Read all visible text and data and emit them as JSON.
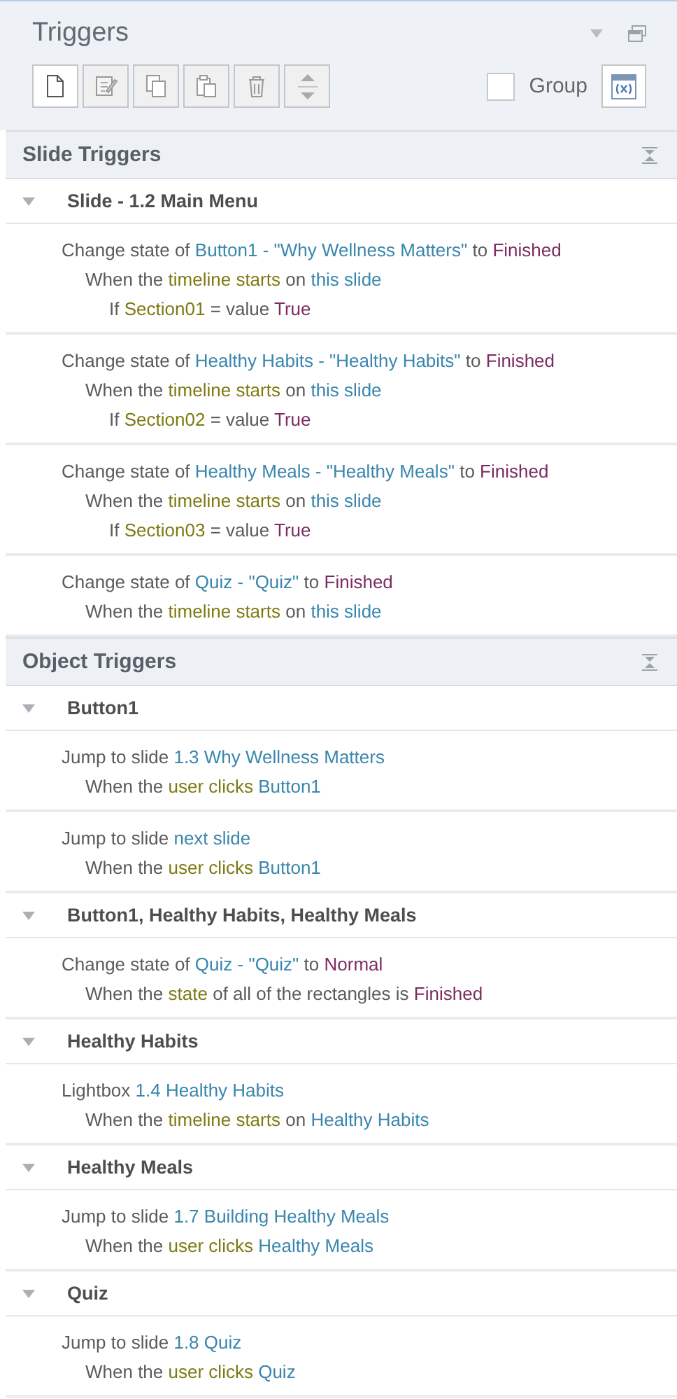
{
  "panel": {
    "title": "Triggers"
  },
  "toolbar": [
    {
      "kind": "new",
      "disabled": false
    },
    {
      "kind": "edit",
      "disabled": true
    },
    {
      "kind": "copy",
      "disabled": true
    },
    {
      "kind": "paste",
      "disabled": true
    },
    {
      "kind": "delete",
      "disabled": true
    },
    {
      "kind": "move",
      "disabled": true
    }
  ],
  "group_option": {
    "label": "Group",
    "checked": false
  },
  "sections": [
    {
      "title": "Slide Triggers",
      "groups": [
        {
          "name": "Slide - 1.2 Main Menu",
          "expanded": true,
          "triggers": [
            {
              "lines": [
                [
                  {
                    "text": "Change state of",
                    "kind": "plain"
                  },
                  {
                    "text": "Button1 - \"Why Wellness Matters\"",
                    "kind": "object"
                  },
                  {
                    "text": "to",
                    "kind": "plain"
                  },
                  {
                    "text": "Finished",
                    "kind": "value"
                  }
                ],
                [
                  {
                    "text": "When the",
                    "kind": "plain"
                  },
                  {
                    "text": "timeline starts",
                    "kind": "event"
                  },
                  {
                    "text": "on",
                    "kind": "plain"
                  },
                  {
                    "text": "this slide",
                    "kind": "object"
                  }
                ],
                [
                  {
                    "text": "If",
                    "kind": "plain"
                  },
                  {
                    "text": "Section01",
                    "kind": "event"
                  },
                  {
                    "text": "= value",
                    "kind": "plain"
                  },
                  {
                    "text": "True",
                    "kind": "value"
                  }
                ]
              ]
            },
            {
              "lines": [
                [
                  {
                    "text": "Change state of",
                    "kind": "plain"
                  },
                  {
                    "text": "Healthy Habits - \"Healthy Habits\"",
                    "kind": "object"
                  },
                  {
                    "text": "to",
                    "kind": "plain"
                  },
                  {
                    "text": "Finished",
                    "kind": "value"
                  }
                ],
                [
                  {
                    "text": "When the",
                    "kind": "plain"
                  },
                  {
                    "text": "timeline starts",
                    "kind": "event"
                  },
                  {
                    "text": "on",
                    "kind": "plain"
                  },
                  {
                    "text": "this slide",
                    "kind": "object"
                  }
                ],
                [
                  {
                    "text": "If",
                    "kind": "plain"
                  },
                  {
                    "text": "Section02",
                    "kind": "event"
                  },
                  {
                    "text": "= value",
                    "kind": "plain"
                  },
                  {
                    "text": "True",
                    "kind": "value"
                  }
                ]
              ]
            },
            {
              "lines": [
                [
                  {
                    "text": "Change state of",
                    "kind": "plain"
                  },
                  {
                    "text": "Healthy Meals - \"Healthy Meals\"",
                    "kind": "object"
                  },
                  {
                    "text": "to",
                    "kind": "plain"
                  },
                  {
                    "text": "Finished",
                    "kind": "value"
                  }
                ],
                [
                  {
                    "text": "When the",
                    "kind": "plain"
                  },
                  {
                    "text": "timeline starts",
                    "kind": "event"
                  },
                  {
                    "text": "on",
                    "kind": "plain"
                  },
                  {
                    "text": "this slide",
                    "kind": "object"
                  }
                ],
                [
                  {
                    "text": "If",
                    "kind": "plain"
                  },
                  {
                    "text": "Section03",
                    "kind": "event"
                  },
                  {
                    "text": "= value",
                    "kind": "plain"
                  },
                  {
                    "text": "True",
                    "kind": "value"
                  }
                ]
              ]
            },
            {
              "lines": [
                [
                  {
                    "text": "Change state of",
                    "kind": "plain"
                  },
                  {
                    "text": "Quiz - \"Quiz\"",
                    "kind": "object"
                  },
                  {
                    "text": "to",
                    "kind": "plain"
                  },
                  {
                    "text": "Finished",
                    "kind": "value"
                  }
                ],
                [
                  {
                    "text": "When the",
                    "kind": "plain"
                  },
                  {
                    "text": "timeline starts",
                    "kind": "event"
                  },
                  {
                    "text": "on",
                    "kind": "plain"
                  },
                  {
                    "text": "this slide",
                    "kind": "object"
                  }
                ]
              ]
            }
          ]
        }
      ]
    },
    {
      "title": "Object Triggers",
      "groups": [
        {
          "name": "Button1",
          "expanded": true,
          "triggers": [
            {
              "lines": [
                [
                  {
                    "text": "Jump to slide",
                    "kind": "plain"
                  },
                  {
                    "text": "1.3 Why Wellness Matters",
                    "kind": "object"
                  }
                ],
                [
                  {
                    "text": "When the",
                    "kind": "plain"
                  },
                  {
                    "text": "user clicks",
                    "kind": "event"
                  },
                  {
                    "text": "Button1",
                    "kind": "object"
                  }
                ]
              ]
            },
            {
              "lines": [
                [
                  {
                    "text": "Jump to slide",
                    "kind": "plain"
                  },
                  {
                    "text": "next slide",
                    "kind": "object"
                  }
                ],
                [
                  {
                    "text": "When the",
                    "kind": "plain"
                  },
                  {
                    "text": "user clicks",
                    "kind": "event"
                  },
                  {
                    "text": "Button1",
                    "kind": "object"
                  }
                ]
              ]
            }
          ]
        },
        {
          "name": "Button1, Healthy Habits, Healthy Meals",
          "expanded": true,
          "triggers": [
            {
              "lines": [
                [
                  {
                    "text": "Change state of",
                    "kind": "plain"
                  },
                  {
                    "text": "Quiz - \"Quiz\"",
                    "kind": "object"
                  },
                  {
                    "text": "to",
                    "kind": "plain"
                  },
                  {
                    "text": "Normal",
                    "kind": "value"
                  }
                ],
                [
                  {
                    "text": "When the",
                    "kind": "plain"
                  },
                  {
                    "text": "state",
                    "kind": "event"
                  },
                  {
                    "text": "of all of the rectangles is",
                    "kind": "plain"
                  },
                  {
                    "text": "Finished",
                    "kind": "value"
                  }
                ]
              ]
            }
          ]
        },
        {
          "name": "Healthy Habits",
          "expanded": true,
          "triggers": [
            {
              "lines": [
                [
                  {
                    "text": "Lightbox",
                    "kind": "plain"
                  },
                  {
                    "text": "1.4 Healthy Habits",
                    "kind": "object"
                  }
                ],
                [
                  {
                    "text": "When the",
                    "kind": "plain"
                  },
                  {
                    "text": "timeline starts",
                    "kind": "event"
                  },
                  {
                    "text": "on",
                    "kind": "plain"
                  },
                  {
                    "text": "Healthy Habits",
                    "kind": "object"
                  }
                ]
              ]
            }
          ]
        },
        {
          "name": "Healthy Meals",
          "expanded": true,
          "triggers": [
            {
              "lines": [
                [
                  {
                    "text": "Jump to slide",
                    "kind": "plain"
                  },
                  {
                    "text": "1.7 Building Healthy Meals",
                    "kind": "object"
                  }
                ],
                [
                  {
                    "text": "When the",
                    "kind": "plain"
                  },
                  {
                    "text": "user clicks",
                    "kind": "event"
                  },
                  {
                    "text": "Healthy Meals",
                    "kind": "object"
                  }
                ]
              ]
            }
          ]
        },
        {
          "name": "Quiz",
          "expanded": true,
          "triggers": [
            {
              "lines": [
                [
                  {
                    "text": "Jump to slide",
                    "kind": "plain"
                  },
                  {
                    "text": "1.8 Quiz",
                    "kind": "object"
                  }
                ],
                [
                  {
                    "text": "When the",
                    "kind": "plain"
                  },
                  {
                    "text": "user clicks",
                    "kind": "event"
                  },
                  {
                    "text": "Quiz",
                    "kind": "object"
                  }
                ]
              ]
            }
          ]
        }
      ]
    }
  ]
}
